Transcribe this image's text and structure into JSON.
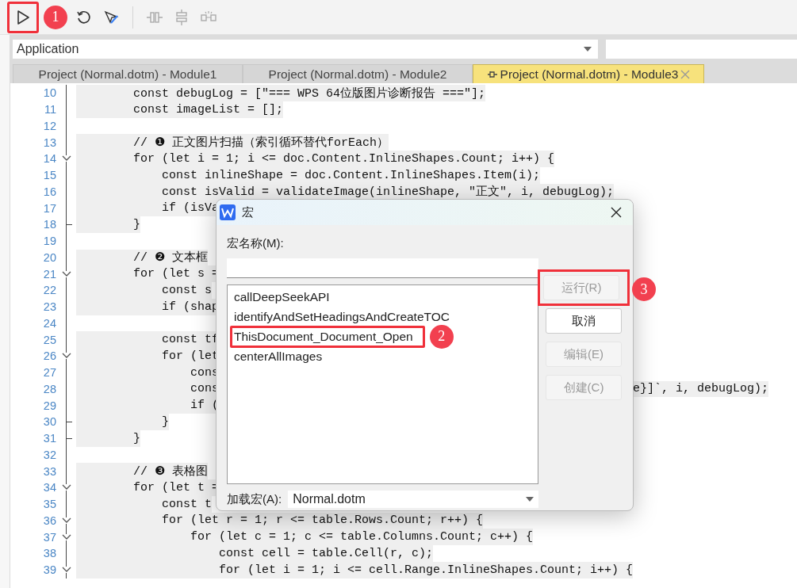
{
  "toolbar": [
    {
      "kind": "run",
      "disabled": false,
      "highlighted": true,
      "badge": "1"
    },
    {
      "kind": "reset",
      "disabled": false,
      "highlighted": false
    },
    {
      "kind": "design",
      "disabled": false,
      "highlighted": false
    },
    {
      "kind": "separator"
    },
    {
      "kind": "step-over",
      "disabled": true,
      "highlighted": false
    },
    {
      "kind": "step-into",
      "disabled": true,
      "highlighted": false
    },
    {
      "kind": "breakpoint",
      "disabled": true,
      "highlighted": false
    }
  ],
  "object_selector": {
    "value": "Application"
  },
  "tabs": [
    {
      "label": "Project (Normal.dotm) - Module1",
      "selected": false
    },
    {
      "label": "Project (Normal.dotm) - Module2",
      "selected": false
    },
    {
      "label": "Project (Normal.dotm) - Module3",
      "selected": true,
      "closable": true
    }
  ],
  "code_lines": [
    {
      "number": "10",
      "text": "        const debugLog = [\"=== WPS 64位版图片诊断报告 ===\"];"
    },
    {
      "number": "11",
      "text": "        const imageList = [];"
    },
    {
      "number": "12"
    },
    {
      "number": "13",
      "text": "        // ❶ 正文图片扫描（索引循环替代forEach）"
    },
    {
      "number": "14",
      "text": "        for (let i = 1; i <= doc.Content.InlineShapes.Count; i++) {",
      "kind": "fold-start"
    },
    {
      "number": "15",
      "text": "            const inlineShape = doc.Content.InlineShapes.Item(i);"
    },
    {
      "number": "16",
      "text": "            const isValid = validateImage(inlineShape, \"正文\", i, debugLog);"
    },
    {
      "number": "17",
      "text": "            if (isVa"
    },
    {
      "number": "18",
      "text": "        }",
      "kind": "fold-end"
    },
    {
      "number": "19"
    },
    {
      "number": "20",
      "text": "        // ❷ 文本框"
    },
    {
      "number": "21",
      "text": "        for (let s =",
      "kind": "fold-start"
    },
    {
      "number": "22",
      "text": "            const s"
    },
    {
      "number": "23",
      "text": "            if (shap"
    },
    {
      "number": "24"
    },
    {
      "number": "25",
      "text": "            const tf"
    },
    {
      "number": "26",
      "text": "            for (let",
      "kind": "fold-start"
    },
    {
      "number": "27",
      "text": "                cons"
    },
    {
      "number": "28",
      "text": "                cons",
      "right_text": "e}]`, i, debugLog);"
    },
    {
      "number": "29",
      "text": "                if ("
    },
    {
      "number": "30",
      "text": "            }",
      "kind": "fold-end"
    },
    {
      "number": "31",
      "text": "        }",
      "kind": "fold-end"
    },
    {
      "number": "32"
    },
    {
      "number": "33",
      "text": "        // ❸ 表格图"
    },
    {
      "number": "34",
      "text": "        for (let t =",
      "kind": "fold-start"
    },
    {
      "number": "35",
      "text": "            const t"
    },
    {
      "number": "36",
      "text": "            for (let r = 1; r <= table.Rows.Count; r++) {",
      "kind": "fold-start"
    },
    {
      "number": "37",
      "text": "                for (let c = 1; c <= table.Columns.Count; c++) {",
      "kind": "fold-start"
    },
    {
      "number": "38",
      "text": "                    const cell = table.Cell(r, c);"
    },
    {
      "number": "39",
      "text": "                    for (let i = 1; i <= cell.Range.InlineShapes.Count; i++) {",
      "kind": "fold-start"
    }
  ],
  "dialog": {
    "title": "宏",
    "name_label": "宏名称(M):",
    "macros": [
      {
        "name": "callDeepSeekAPI",
        "highlighted": false
      },
      {
        "name": "identifyAndSetHeadingsAndCreateTOC",
        "highlighted": false
      },
      {
        "name": "ThisDocument_Document_Open",
        "highlighted": true,
        "badge": "2"
      },
      {
        "name": "centerAllImages",
        "highlighted": false
      }
    ],
    "buttons": [
      {
        "label": "运行(R)",
        "disabled": true,
        "highlighted": true,
        "badge": "3"
      },
      {
        "label": "取消",
        "disabled": false,
        "highlighted": false
      },
      {
        "label": "编辑(E)",
        "disabled": true,
        "highlighted": false
      },
      {
        "label": "创建(C)",
        "disabled": true,
        "highlighted": false
      }
    ],
    "macros_in_label": "加载宏(A):",
    "macros_in_value": "Normal.dotm"
  }
}
